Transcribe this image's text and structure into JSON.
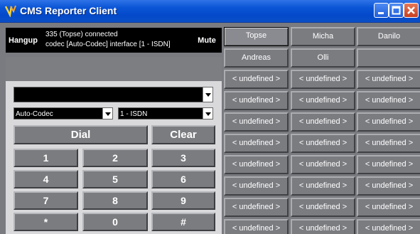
{
  "window": {
    "title": "CMS Reporter Client"
  },
  "status": {
    "hangup_label": "Hangup",
    "line1": "335 (Topse) connected",
    "line2": "codec [Auto-Codec]  interface [1 - ISDN]",
    "mute_label": "Mute"
  },
  "dial": {
    "number_value": "",
    "codec_selected": "Auto-Codec",
    "interface_selected": "1 - ISDN",
    "dial_label": "Dial",
    "clear_label": "Clear",
    "keys": [
      "1",
      "2",
      "3",
      "4",
      "5",
      "6",
      "7",
      "8",
      "9",
      "*",
      "0",
      "#"
    ]
  },
  "speed_dial": [
    [
      "Topse",
      "Micha",
      "Danilo"
    ],
    [
      "Andreas",
      "Olli",
      ""
    ],
    [
      "< undefined >",
      "< undefined >",
      "< undefined >"
    ],
    [
      "< undefined >",
      "< undefined >",
      "< undefined >"
    ],
    [
      "< undefined >",
      "< undefined >",
      "< undefined >"
    ],
    [
      "< undefined >",
      "< undefined >",
      "< undefined >"
    ],
    [
      "< undefined >",
      "< undefined >",
      "< undefined >"
    ],
    [
      "< undefined >",
      "< undefined >",
      "< undefined >"
    ],
    [
      "< undefined >",
      "< undefined >",
      "< undefined >"
    ],
    [
      "< undefined >",
      "< undefined >",
      "< undefined >"
    ]
  ],
  "icons": {
    "app": "app-icon",
    "minimize": "minimize-icon",
    "maximize": "maximize-icon",
    "close": "close-icon",
    "dropdown": "chevron-down-icon"
  }
}
